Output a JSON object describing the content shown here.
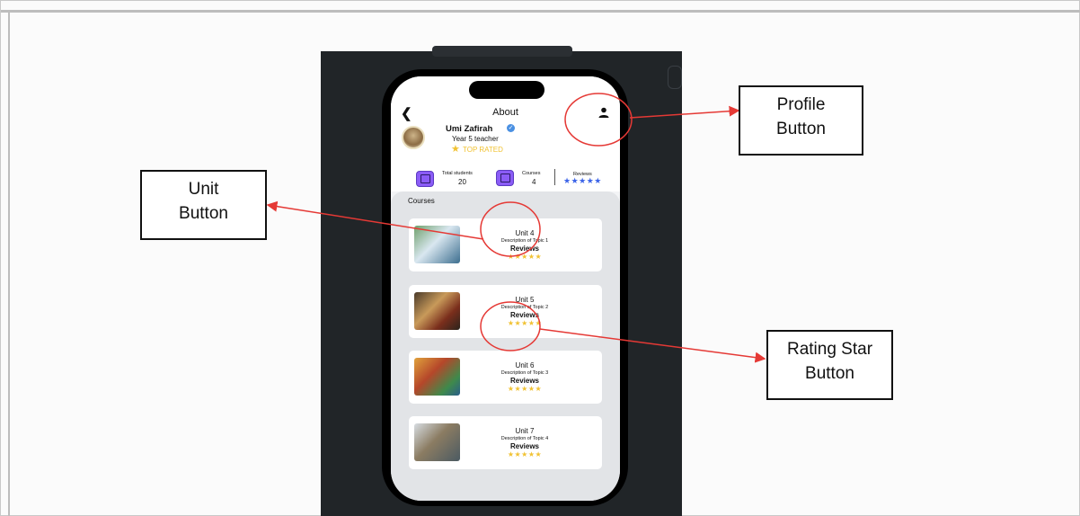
{
  "app": {
    "page_title": "About",
    "back_icon": "chevron-left-icon",
    "profile_icon": "user-icon"
  },
  "teacher": {
    "name": "Umi Zafirah",
    "role": "Year 5 teacher",
    "badge": "TOP RATED",
    "badge_icon": "star-icon",
    "verified_icon": "verified-check-icon"
  },
  "stats": {
    "students_label": "Total students",
    "students_value": "20",
    "courses_label": "Courses",
    "courses_value": "4",
    "reviews_label": "Reviews",
    "reviews_stars": "★★★★★"
  },
  "courses": {
    "section_title": "Courses",
    "items": [
      {
        "title": "Unit 4",
        "description": "Description of Topic 1",
        "reviews": "Reviews",
        "stars": "★★★★★"
      },
      {
        "title": "Unit 5",
        "description": "Description of Topic 2",
        "reviews": "Reviews",
        "stars": "★★★★★"
      },
      {
        "title": "Unit 6",
        "description": "Description of Topic 3",
        "reviews": "Reviews",
        "stars": "★★★★★"
      },
      {
        "title": "Unit 7",
        "description": "Description of Topic 4",
        "reviews": "Reviews",
        "stars": "★★★★★"
      }
    ]
  },
  "annotations": {
    "profile_line1": "Profile",
    "profile_line2": "Button",
    "unit_line1": "Unit",
    "unit_line2": "Button",
    "rating_line1": "Rating Star",
    "rating_line2": "Button"
  },
  "colors": {
    "accent_red": "#e53935",
    "star_gold": "#f1c232",
    "review_blue": "#3b63e8",
    "stat_purple": "#8b5cf6"
  }
}
